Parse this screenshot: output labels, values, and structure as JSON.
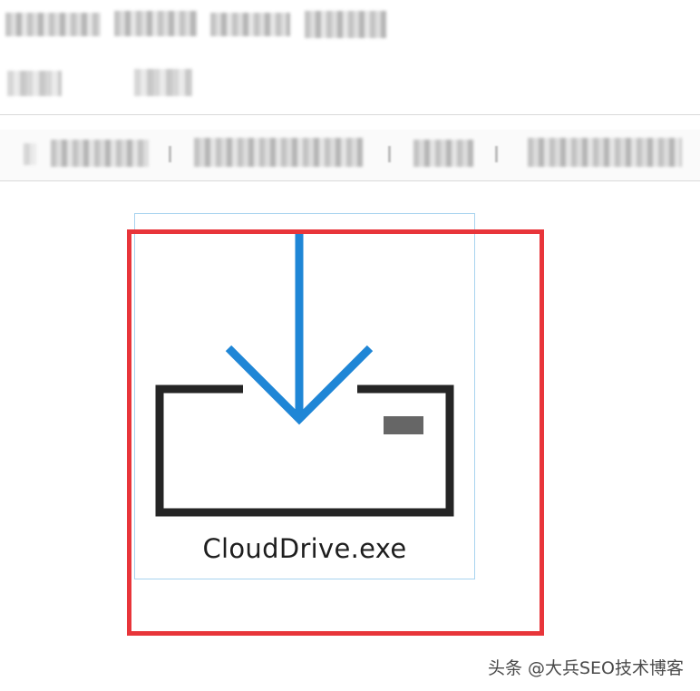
{
  "window": {
    "title_redacted": "",
    "subtitle_redacted": ""
  },
  "breadcrumb": {
    "items_redacted": [
      "",
      "",
      "",
      ""
    ]
  },
  "file": {
    "name": "CloudDrive.exe",
    "icon": "installer-download-icon",
    "selected": true
  },
  "colors": {
    "arrow_blue": "#1f86d6",
    "box_dark": "#252525",
    "highlight_red": "#e8353a",
    "selection_border": "#a8d3ef"
  },
  "watermark": {
    "text": "头条 @大兵SEO技术博客"
  }
}
